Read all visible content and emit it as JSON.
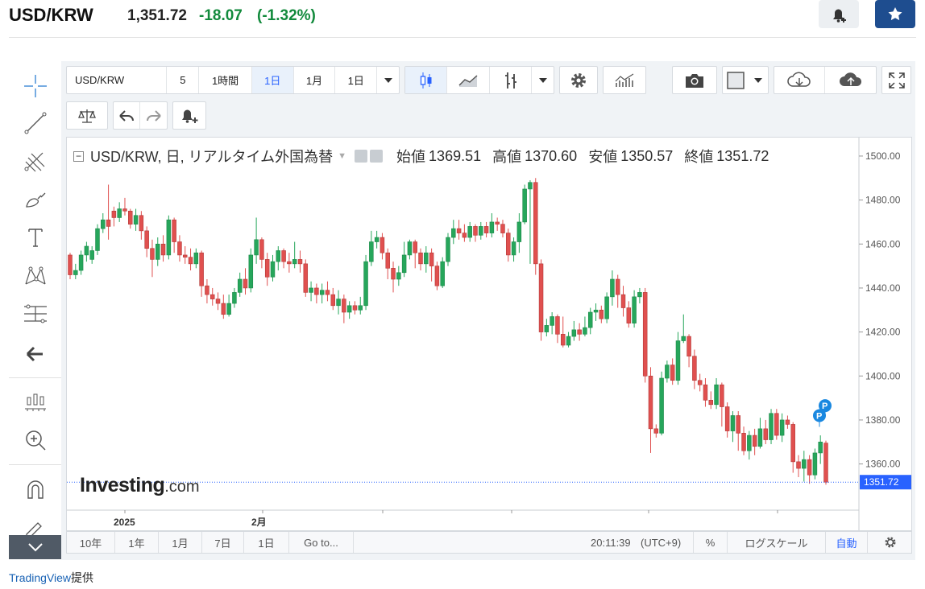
{
  "quote": {
    "symbol": "USD/KRW",
    "price": "1,351.72",
    "change": "-18.07",
    "change_pct": "(-1.32%)"
  },
  "toolbar": {
    "symbol": "USD/KRW",
    "intervals": [
      "5",
      "1時間",
      "1日",
      "1月",
      "1日"
    ],
    "active_interval": "1日"
  },
  "legend": {
    "title": "USD/KRW, 日, リアルタイム外国為替",
    "open_label": "始値",
    "open": "1369.51",
    "high_label": "高値",
    "high": "1370.60",
    "low_label": "安値",
    "low": "1350.57",
    "close_label": "終値",
    "close": "1351.72"
  },
  "watermark": {
    "brand": "Investing",
    "suffix": ".com"
  },
  "price_label": "1351.72",
  "bottom": {
    "ranges": [
      "10年",
      "1年",
      "1月",
      "7日",
      "1日"
    ],
    "goto": "Go to...",
    "time": "20:11:39",
    "tz": "(UTC+9)",
    "pct": "%",
    "log": "ログスケール",
    "auto": "自動"
  },
  "footer": {
    "provider": "TradingView",
    "suffix": "提供"
  },
  "colors": {
    "up": "#26a65b",
    "down": "#e0504f",
    "accent": "#2962ff",
    "brand": "#1e4d8f"
  },
  "chart_data": {
    "type": "candlestick",
    "title": "USD/KRW, 日, リアルタイム外国為替",
    "x_tick_labels": [
      "2025",
      "2月"
    ],
    "y_ticks": [
      1360,
      1380,
      1400,
      1420,
      1440,
      1460,
      1480,
      1500
    ],
    "ylim": [
      1339,
      1504
    ],
    "last_price": 1351.72,
    "candles": [
      [
        1455,
        1446,
        1456,
        1444
      ],
      [
        1446,
        1448,
        1451,
        1444
      ],
      [
        1448,
        1455,
        1457,
        1446
      ],
      [
        1455,
        1459,
        1461,
        1452
      ],
      [
        1453,
        1457,
        1459,
        1451
      ],
      [
        1457,
        1467,
        1469,
        1455
      ],
      [
        1467,
        1471,
        1474,
        1465
      ],
      [
        1471,
        1468,
        1487,
        1462
      ],
      [
        1475,
        1472,
        1477,
        1468
      ],
      [
        1472,
        1476,
        1479,
        1470
      ],
      [
        1476,
        1475,
        1481,
        1473
      ],
      [
        1475,
        1469,
        1476,
        1467
      ],
      [
        1469,
        1473,
        1476,
        1466
      ],
      [
        1473,
        1466,
        1475,
        1462
      ],
      [
        1466,
        1458,
        1468,
        1454
      ],
      [
        1458,
        1453,
        1462,
        1445
      ],
      [
        1453,
        1460,
        1463,
        1450
      ],
      [
        1460,
        1455,
        1464,
        1452
      ],
      [
        1455,
        1471,
        1473,
        1453
      ],
      [
        1471,
        1461,
        1472,
        1456
      ],
      [
        1461,
        1455,
        1464,
        1452
      ],
      [
        1455,
        1454,
        1459,
        1451
      ],
      [
        1454,
        1451,
        1458,
        1448
      ],
      [
        1451,
        1456,
        1458,
        1449
      ],
      [
        1456,
        1441,
        1457,
        1436
      ],
      [
        1441,
        1437,
        1444,
        1433
      ],
      [
        1437,
        1435,
        1440,
        1432
      ],
      [
        1435,
        1433,
        1438,
        1430
      ],
      [
        1433,
        1428,
        1437,
        1426
      ],
      [
        1428,
        1433,
        1437,
        1427
      ],
      [
        1433,
        1438,
        1440,
        1431
      ],
      [
        1438,
        1444,
        1447,
        1436
      ],
      [
        1444,
        1440,
        1449,
        1437
      ],
      [
        1440,
        1455,
        1458,
        1438
      ],
      [
        1455,
        1462,
        1472,
        1451
      ],
      [
        1462,
        1453,
        1463,
        1449
      ],
      [
        1453,
        1445,
        1456,
        1441
      ],
      [
        1445,
        1452,
        1455,
        1443
      ],
      [
        1452,
        1457,
        1459,
        1448
      ],
      [
        1457,
        1452,
        1458,
        1449
      ],
      [
        1452,
        1451,
        1456,
        1447
      ],
      [
        1451,
        1453,
        1461,
        1449
      ],
      [
        1453,
        1451,
        1457,
        1447
      ],
      [
        1451,
        1438,
        1453,
        1436
      ],
      [
        1438,
        1440,
        1443,
        1434
      ],
      [
        1440,
        1437,
        1442,
        1433
      ],
      [
        1437,
        1439,
        1442,
        1433
      ],
      [
        1439,
        1437,
        1443,
        1434
      ],
      [
        1437,
        1432,
        1440,
        1430
      ],
      [
        1432,
        1435,
        1439,
        1428
      ],
      [
        1435,
        1429,
        1437,
        1424
      ],
      [
        1429,
        1432,
        1434,
        1426
      ],
      [
        1432,
        1430,
        1434,
        1428
      ],
      [
        1430,
        1432,
        1436,
        1428
      ],
      [
        1432,
        1452,
        1455,
        1430
      ],
      [
        1452,
        1461,
        1466,
        1450
      ],
      [
        1461,
        1463,
        1466,
        1458
      ],
      [
        1463,
        1456,
        1465,
        1453
      ],
      [
        1456,
        1449,
        1458,
        1444
      ],
      [
        1449,
        1444,
        1452,
        1438
      ],
      [
        1444,
        1447,
        1450,
        1441
      ],
      [
        1447,
        1455,
        1461,
        1445
      ],
      [
        1455,
        1461,
        1462,
        1453
      ],
      [
        1461,
        1456,
        1462,
        1449
      ],
      [
        1456,
        1451,
        1458,
        1448
      ],
      [
        1451,
        1456,
        1459,
        1447
      ],
      [
        1456,
        1450,
        1458,
        1443
      ],
      [
        1450,
        1441,
        1452,
        1439
      ],
      [
        1441,
        1452,
        1454,
        1440
      ],
      [
        1452,
        1463,
        1465,
        1450
      ],
      [
        1463,
        1467,
        1471,
        1460
      ],
      [
        1467,
        1465,
        1471,
        1462
      ],
      [
        1465,
        1463,
        1469,
        1461
      ],
      [
        1463,
        1468,
        1470,
        1461
      ],
      [
        1468,
        1464,
        1469,
        1461
      ],
      [
        1464,
        1468,
        1470,
        1462
      ],
      [
        1468,
        1465,
        1470,
        1463
      ],
      [
        1465,
        1470,
        1474,
        1463
      ],
      [
        1470,
        1469,
        1472,
        1466
      ],
      [
        1469,
        1465,
        1471,
        1463
      ],
      [
        1465,
        1455,
        1467,
        1452
      ],
      [
        1455,
        1461,
        1463,
        1452
      ],
      [
        1461,
        1470,
        1474,
        1456
      ],
      [
        1470,
        1485,
        1487,
        1469
      ],
      [
        1485,
        1488,
        1489,
        1451
      ],
      [
        1488,
        1451,
        1490,
        1446
      ],
      [
        1451,
        1420,
        1453,
        1416
      ],
      [
        1420,
        1423,
        1426,
        1418
      ],
      [
        1423,
        1427,
        1429,
        1419
      ],
      [
        1427,
        1419,
        1428,
        1415
      ],
      [
        1419,
        1414,
        1427,
        1413
      ],
      [
        1414,
        1418,
        1420,
        1413
      ],
      [
        1418,
        1421,
        1425,
        1416
      ],
      [
        1421,
        1419,
        1424,
        1416
      ],
      [
        1419,
        1422,
        1427,
        1418
      ],
      [
        1422,
        1429,
        1431,
        1419
      ],
      [
        1429,
        1430,
        1433,
        1425
      ],
      [
        1430,
        1426,
        1432,
        1424
      ],
      [
        1426,
        1436,
        1438,
        1424
      ],
      [
        1436,
        1444,
        1448,
        1432
      ],
      [
        1444,
        1437,
        1446,
        1431
      ],
      [
        1437,
        1431,
        1441,
        1427
      ],
      [
        1431,
        1424,
        1434,
        1422
      ],
      [
        1424,
        1436,
        1439,
        1422
      ],
      [
        1436,
        1438,
        1440,
        1433
      ],
      [
        1438,
        1400,
        1440,
        1397
      ],
      [
        1400,
        1376,
        1404,
        1365
      ],
      [
        1376,
        1374,
        1378,
        1372
      ],
      [
        1374,
        1399,
        1402,
        1373
      ],
      [
        1399,
        1405,
        1407,
        1397
      ],
      [
        1405,
        1398,
        1408,
        1396
      ],
      [
        1398,
        1416,
        1420,
        1396
      ],
      [
        1416,
        1418,
        1428,
        1415
      ],
      [
        1418,
        1409,
        1419,
        1404
      ],
      [
        1409,
        1398,
        1412,
        1394
      ],
      [
        1398,
        1396,
        1401,
        1393
      ],
      [
        1396,
        1389,
        1399,
        1386
      ],
      [
        1389,
        1387,
        1393,
        1385
      ],
      [
        1387,
        1396,
        1399,
        1385
      ],
      [
        1396,
        1386,
        1397,
        1377
      ],
      [
        1386,
        1375,
        1388,
        1372
      ],
      [
        1375,
        1382,
        1384,
        1370
      ],
      [
        1382,
        1374,
        1384,
        1366
      ],
      [
        1374,
        1366,
        1377,
        1364
      ],
      [
        1366,
        1373,
        1375,
        1362
      ],
      [
        1373,
        1368,
        1376,
        1364
      ],
      [
        1368,
        1376,
        1381,
        1367
      ],
      [
        1376,
        1371,
        1380,
        1369
      ],
      [
        1371,
        1383,
        1385,
        1369
      ],
      [
        1383,
        1373,
        1385,
        1371
      ],
      [
        1373,
        1380,
        1383,
        1370
      ],
      [
        1380,
        1378,
        1382,
        1376
      ],
      [
        1378,
        1361,
        1379,
        1356
      ],
      [
        1361,
        1358,
        1364,
        1354
      ],
      [
        1358,
        1362,
        1366,
        1352
      ],
      [
        1362,
        1355,
        1364,
        1351
      ],
      [
        1355,
        1365,
        1367,
        1353
      ],
      [
        1365,
        1370,
        1373,
        1360
      ],
      [
        1369.51,
        1351.72,
        1370.6,
        1350.57
      ]
    ]
  }
}
